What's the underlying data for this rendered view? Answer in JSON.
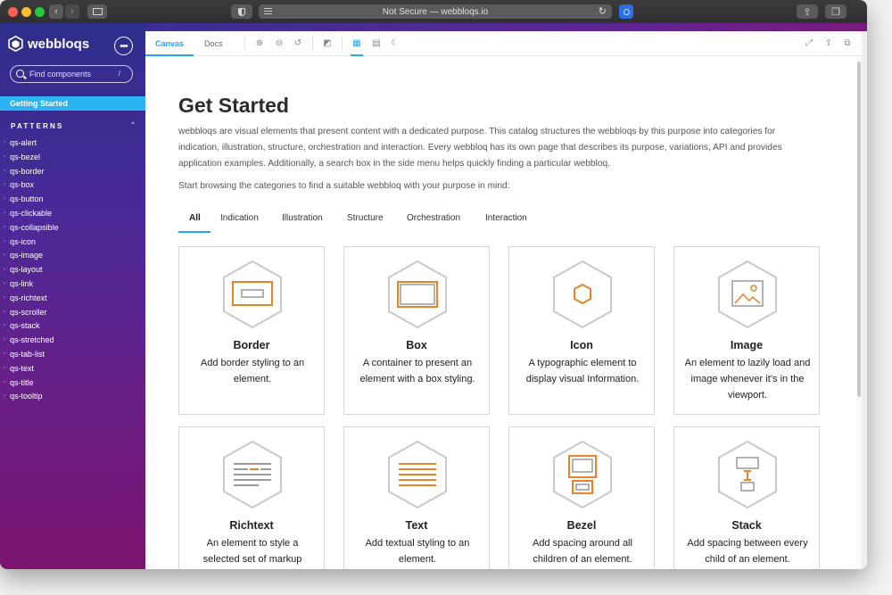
{
  "browser": {
    "url_text": "Not Secure — webbloqs.io"
  },
  "sidebar": {
    "brand": "webbloqs",
    "search_placeholder": "Find components",
    "search_shortcut": "/",
    "active_item": "Getting Started",
    "section_title": "PATTERNS",
    "items": [
      "qs-alert",
      "qs-bezel",
      "qs-border",
      "qs-box",
      "qs-button",
      "qs-clickable",
      "qs-collapsible",
      "qs-icon",
      "qs-image",
      "qs-layout",
      "qs-link",
      "qs-richtext",
      "qs-scroller",
      "qs-stack",
      "qs-stretched",
      "qs-tab-list",
      "qs-text",
      "qs-title",
      "qs-tooltip"
    ]
  },
  "toolbar": {
    "canvas_tab": "Canvas",
    "docs_tab": "Docs"
  },
  "main": {
    "title": "Get Started",
    "intro": "webbloqs are visual elements that present content with a dedicated purpose. This catalog structures the webbloqs by this purpose into categories for indication, illustration, structure, orchestration and interaction. Every webbloq has its own page that describes its purpose, variations, API and provides application examples. Additionally, a search box in the side menu helps quickly finding a particular webbloq.",
    "browse": "Start browsing the categories to find a suitable webbloq with your purpose in mind:",
    "tabs": [
      "All",
      "Indication",
      "Illustration",
      "Structure",
      "Orchestration",
      "Interaction"
    ],
    "cards": [
      {
        "name": "Border",
        "desc": "Add border styling to an element."
      },
      {
        "name": "Box",
        "desc": "A container to present an element with a box styling."
      },
      {
        "name": "Icon",
        "desc": "A typographic element to display visual Information."
      },
      {
        "name": "Image",
        "desc": "An element to lazily load and image whenever it’s in the viewport."
      },
      {
        "name": "Richtext",
        "desc": "An element to style a selected set of markup elements."
      },
      {
        "name": "Text",
        "desc": "Add textual styling to an element."
      },
      {
        "name": "Bezel",
        "desc": "Add spacing around all children of an element."
      },
      {
        "name": "Stack",
        "desc": "Add spacing between every child of an element."
      }
    ]
  },
  "colors": {
    "accent": "#1ea7fd",
    "illustration_orange": "#e8832a",
    "hex_gray": "#c9c9c9"
  }
}
